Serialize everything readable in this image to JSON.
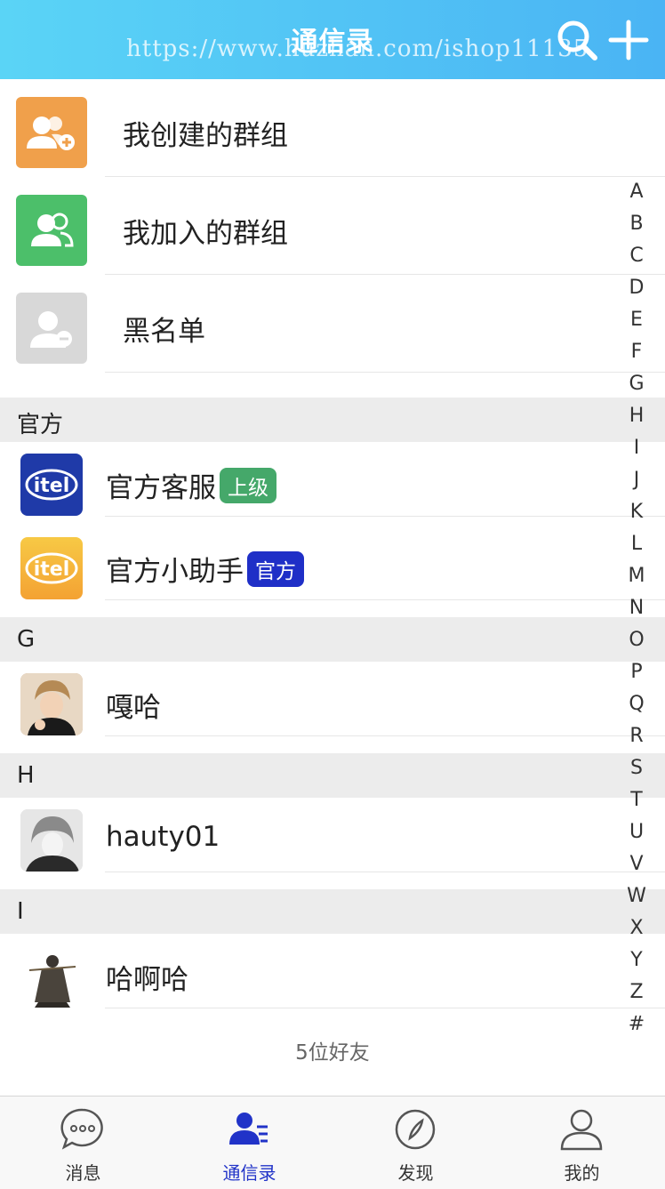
{
  "header": {
    "title": "通信录",
    "watermark": "https://www.huzhan.com/ishop11135"
  },
  "functions": [
    {
      "label": "我创建的群组",
      "icon": "create-group-icon",
      "color": "#f0a04b"
    },
    {
      "label": "我加入的群组",
      "icon": "joined-group-icon",
      "color": "#4cbf6a"
    },
    {
      "label": "黑名单",
      "icon": "blacklist-icon",
      "color": "#d8d8d8"
    }
  ],
  "sections": {
    "official": "官方",
    "g": "G",
    "h": "H",
    "i": "I"
  },
  "contacts": {
    "official_service": {
      "name": "官方客服",
      "badge": "上级",
      "badge_color": "#45a86a",
      "avatar": "itel-logo"
    },
    "official_helper": {
      "name": "官方小助手",
      "badge": "官方",
      "badge_color": "#1f2fc7",
      "avatar": "itel-logo"
    },
    "gaha": {
      "name": "嘎哈"
    },
    "hauty": {
      "name": "hauty01"
    },
    "haaha": {
      "name": "哈啊哈"
    }
  },
  "index_letters": [
    "A",
    "B",
    "C",
    "D",
    "E",
    "F",
    "G",
    "H",
    "I",
    "J",
    "K",
    "L",
    "M",
    "N",
    "O",
    "P",
    "Q",
    "R",
    "S",
    "T",
    "U",
    "V",
    "W",
    "X",
    "Y",
    "Z",
    "#"
  ],
  "friend_count": "5位好友",
  "tabs": [
    {
      "label": "消息",
      "icon": "chat-bubble-icon"
    },
    {
      "label": "通信录",
      "icon": "contacts-icon",
      "active": true
    },
    {
      "label": "发现",
      "icon": "compass-icon"
    },
    {
      "label": "我的",
      "icon": "person-icon"
    }
  ],
  "colors": {
    "header_start": "#5ad4f6",
    "header_end": "#4ab4f4",
    "active_tab": "#2133c8"
  }
}
